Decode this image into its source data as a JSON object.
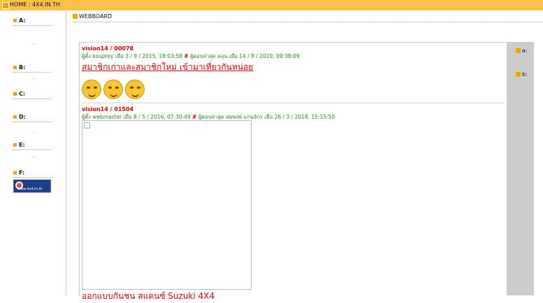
{
  "topbar": {
    "title": "HOME : 4X4.IN.TH"
  },
  "sidebar": {
    "categories": [
      "A:",
      "B:",
      "C:",
      "D:",
      "E:",
      "F:"
    ],
    "banner_text": "www.4x4.in.th"
  },
  "webboard": {
    "heading": "WEBBOARD"
  },
  "right_panel": {
    "labels": [
      "a:",
      "b:"
    ]
  },
  "posts": [
    {
      "title": "vision14 / 00078",
      "meta_posted": "ผู้ตั้ง kouprey เมื่อ 3 / 9 / 2015, 18:03:58",
      "hash": "#",
      "meta_reply": "ผู้ตอบล่าสุด ลลุน เมื่อ 14 / 8 / 2019, 09:38:09",
      "link": "สมาชิกเก่าและสมาชิกใหม่ เข้ามาเที่ยวกันหน่อย"
    },
    {
      "title": "vision14 / 01504",
      "meta_posted": "ผู้ตั้ง webmaster เมื่อ 8 / 5 / 2016, 07:30:49",
      "hash": "#",
      "meta_reply": "ผู้ตอบล่าสุด สมพงษ์ แก่นจักร เมื่อ 26 / 3 / 2018, 15:15:50",
      "link_cutoff": "ออกแบบกันชน สแตนซ์ Suzuki 4X4"
    }
  ],
  "colors": {
    "topbar": "#f9c14a",
    "accent": "#f7a400",
    "link": "#d80000",
    "meta": "#1a8f1a",
    "rightcol": "#cccccc"
  }
}
